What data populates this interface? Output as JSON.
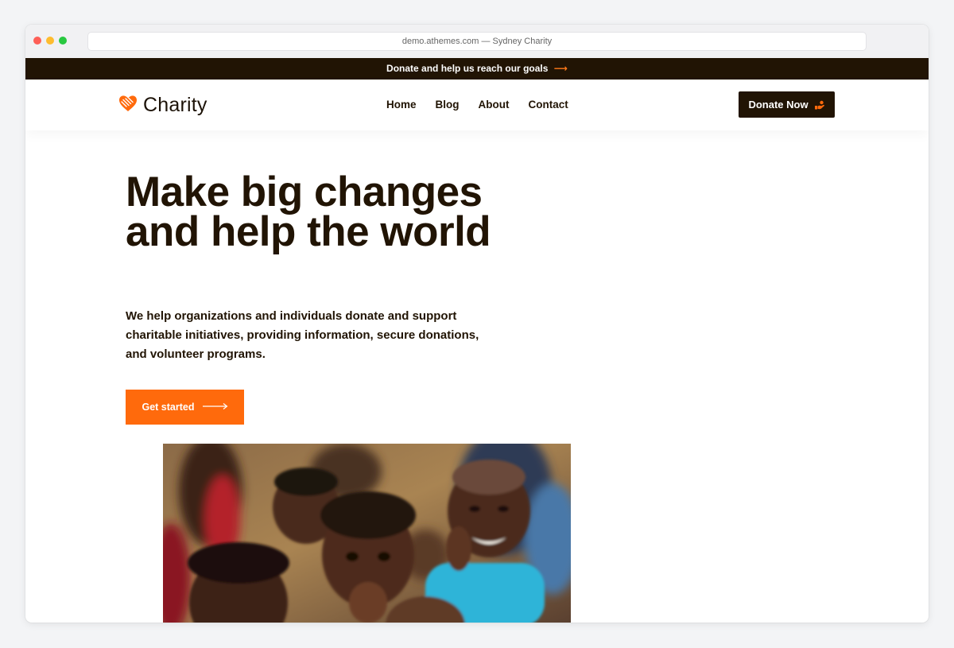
{
  "browser": {
    "url_text": "demo.athemes.com — Sydney Charity"
  },
  "announcement": {
    "text": "Donate and help us reach our goals",
    "arrow": "⟶"
  },
  "header": {
    "logo_text": "Charity",
    "nav": [
      "Home",
      "Blog",
      "About",
      "Contact"
    ],
    "donate_label": "Donate Now"
  },
  "hero": {
    "title": "Make big changes and help the world",
    "description": "We help organizations and individuals donate and support charitable initiatives, providing information, secure donations, and volunteer programs.",
    "cta_label": "Get started"
  },
  "colors": {
    "dark": "#211404",
    "accent": "#ff6a0c",
    "background": "#ffffff"
  },
  "icons": {
    "logo": "heart-hand-icon",
    "donate": "donate-hand-icon",
    "cta": "arrow-right-icon"
  }
}
